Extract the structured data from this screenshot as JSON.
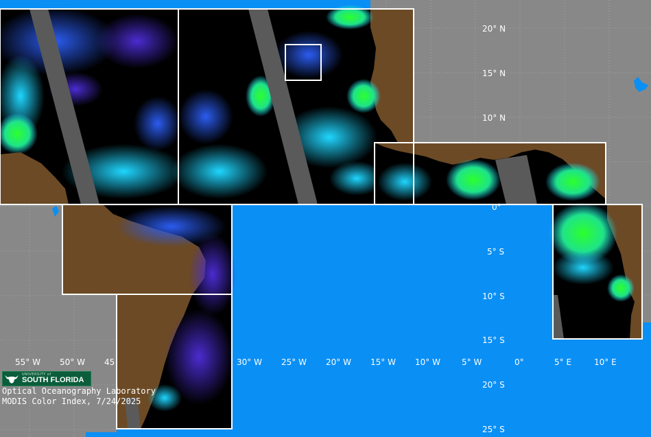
{
  "map": {
    "colors": {
      "background_nodata": "#888888",
      "ocean_unprocessed": "#0a8ff5",
      "land": "#6b4a25",
      "clouds": "#000000",
      "swath_gap": "#5a5a5a",
      "tile_border": "#ffffff",
      "low_index": "#3a2cb8",
      "mid_index": "#1fd6ff",
      "high_index": "#2cff2c"
    },
    "lat_labels": [
      "20° N",
      "15° N",
      "10° N",
      "0°",
      "5° S",
      "10° S",
      "15° S",
      "20° S",
      "25° S"
    ],
    "lon_labels": [
      "55° W",
      "50° W",
      "45",
      "30° W",
      "25° W",
      "20° W",
      "15° W",
      "10° W",
      "5° W",
      "0°",
      "5° E",
      "10° E"
    ]
  },
  "credits": {
    "logo_small": "UNIVERSITY of",
    "logo_name": "SOUTH FLORIDA",
    "logo_icon": "usf-bull-icon",
    "line1": "Optical Oceanography Laboratory",
    "line2": "MODIS Color Index, 7/24/2025"
  }
}
